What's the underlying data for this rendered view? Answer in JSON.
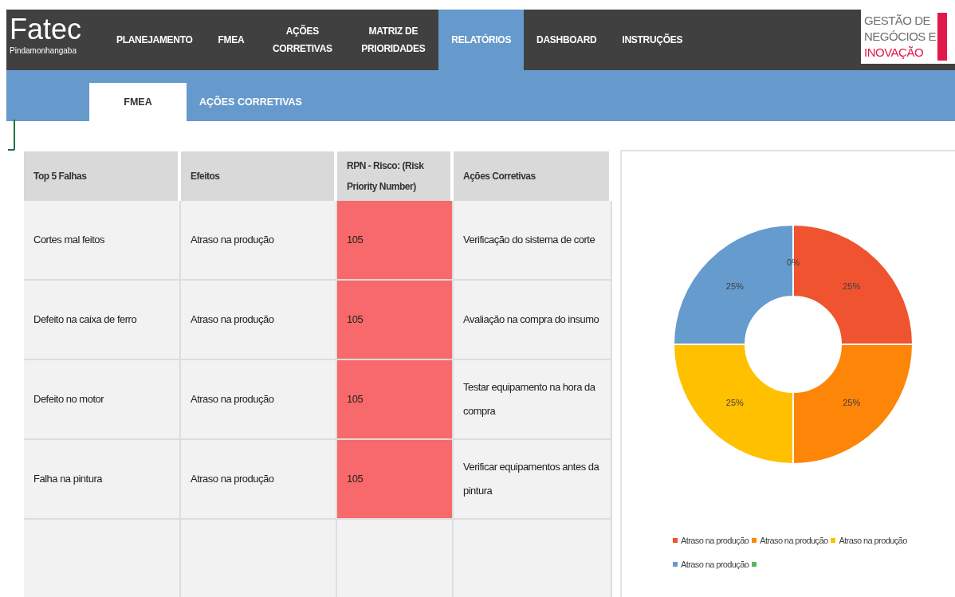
{
  "brand": {
    "name": "Fatec",
    "subtitle": "Pindamonhangaba"
  },
  "nav": [
    {
      "label": "PLANEJAMENTO",
      "selected": false
    },
    {
      "label": "FMEA",
      "selected": false
    },
    {
      "label": "AÇÕES CORRETIVAS",
      "selected": false
    },
    {
      "label": "MATRIZ DE PRIORIDADES",
      "selected": false
    },
    {
      "label": "RELATÓRIOS",
      "selected": true
    },
    {
      "label": "DASHBOARD",
      "selected": false
    },
    {
      "label": "INSTRUÇÕES",
      "selected": false
    }
  ],
  "partner_logo": {
    "lines": [
      "GESTÃO DE",
      "NEGÓCIOS E",
      "INOVAÇÃO"
    ]
  },
  "tabs": [
    {
      "label": "FMEA",
      "selected": true
    },
    {
      "label": "AÇÕES CORRETIVAS",
      "selected": false
    }
  ],
  "table": {
    "columns": [
      "Top 5 Falhas",
      "Efeitos",
      "RPN - Risco: (Risk Priority Number)",
      "Ações Corretivas"
    ],
    "rows": [
      [
        "Cortes mal feitos",
        "Atraso na produção",
        "105",
        "Verificação do sistema de corte"
      ],
      [
        "Defeito na caixa de ferro",
        "Atraso na produção",
        "105",
        "Avaliação na compra do insumo"
      ],
      [
        "Defeito no motor",
        "Atraso na produção",
        "105",
        "Testar equipamento na hora da compra"
      ],
      [
        "Falha na pintura",
        "Atraso na produção",
        "105",
        "Verificar equipamentos antes da pintura"
      ]
    ]
  },
  "chart": {
    "chart_data": {
      "type": "donut",
      "categories": [
        "Atraso na produção",
        "Atraso na produção",
        "Atraso na produção",
        "Atraso na produção"
      ],
      "values": [
        25,
        25,
        25,
        25
      ],
      "colors": [
        "#ef5330",
        "#fd8508",
        "#ffc000",
        "#669bcd"
      ],
      "value_labels": [
        "25%",
        "25%",
        "25%",
        "25%"
      ]
    },
    "empty_slice": {
      "value_label": "0%",
      "color": "#5cb85c"
    }
  }
}
